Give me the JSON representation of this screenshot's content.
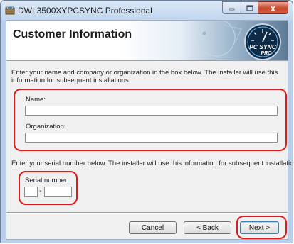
{
  "window": {
    "title": "DWL3500XYPCSYNC Professional",
    "close_glyph": "x"
  },
  "header": {
    "title": "Customer Information",
    "logo": {
      "line1": "PC SYNC",
      "line2": "PRO"
    }
  },
  "instructions": "Enter your name and company or organization in the box below. The installer will use this information for subsequent installations.",
  "form": {
    "name_label": "Name:",
    "name_value": "",
    "organization_label": "Organization:",
    "organization_value": "",
    "serial_instructions": "Enter your serial number below. The installer will use this information for subsequent installations.",
    "serial_label": "Serial number:",
    "serial_part1": "",
    "serial_separator": "-",
    "serial_part2": ""
  },
  "buttons": {
    "cancel": "Cancel",
    "back": "< Back",
    "next": "Next >"
  },
  "colors": {
    "callout": "#e01a1a",
    "titlebar": "#c1d6ef",
    "close_button": "#c8452c"
  }
}
